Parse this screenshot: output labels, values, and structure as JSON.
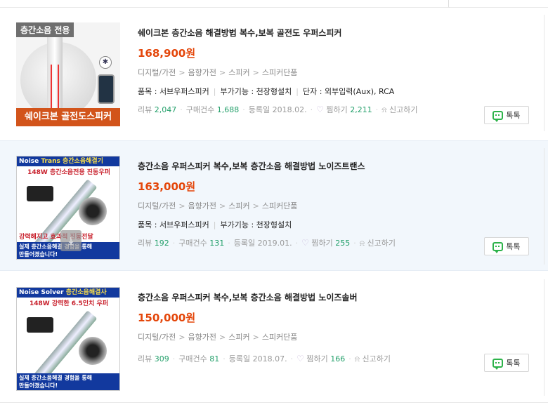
{
  "products": [
    {
      "title": "쉐이크본 층간소음 해결방법 복수,보복 골전도 우퍼스피커",
      "price": "168,900원",
      "categories": [
        "디지털/가전",
        "음향가전",
        "스피커",
        "스피커단품"
      ],
      "specs": [
        "품목 : 서브우퍼스피커",
        "부가기능 : 천장형설치",
        "단자 : 외부입력(Aux), RCA"
      ],
      "review_label": "리뷰",
      "review_count": "2,047",
      "purchase_label": "구매건수",
      "purchase_count": "1,688",
      "reg_label": "등록일 2018.02.",
      "wish_label": "찜하기",
      "wish_count": "2,211",
      "report_label": "신고하기",
      "talk_label": "톡톡",
      "thumb": {
        "badge": "층간소음 전용",
        "footer": "쉐이크본 골전도스피커",
        "bt_glyph": "✱"
      }
    },
    {
      "title": "층간소음 우퍼스피커 복수,보복 층간소음 해결방법 노이즈트랜스",
      "price": "163,000원",
      "categories": [
        "디지털/가전",
        "음향가전",
        "스피커",
        "스피커단품"
      ],
      "specs": [
        "품목 : 서브우퍼스피커",
        "부가기능 : 천장형설치"
      ],
      "review_label": "리뷰",
      "review_count": "192",
      "purchase_label": "구매건수",
      "purchase_count": "131",
      "reg_label": "등록일 2019.01.",
      "wish_label": "찜하기",
      "wish_count": "255",
      "report_label": "신고하기",
      "talk_label": "톡톡",
      "thumb": {
        "header_a": "Noise",
        "header_b": "Trans",
        "header_c": "층간소음해결기",
        "sub": "148W 층간소음전용 진동우퍼",
        "red": "강력해지고 효과적 진동전달",
        "foot1": "실제 층간소음해결 경험을 통해",
        "foot2": "만들어졌습니다!",
        "download_glyph": "⤓"
      }
    },
    {
      "title": "층간소음 우퍼스피커 복수,보복 층간소음 해결방법 노이즈솔버",
      "price": "150,000원",
      "categories": [
        "디지털/가전",
        "음향가전",
        "스피커",
        "스피커단품"
      ],
      "specs": [],
      "review_label": "리뷰",
      "review_count": "309",
      "purchase_label": "구매건수",
      "purchase_count": "81",
      "reg_label": "등록일 2018.07.",
      "wish_label": "찜하기",
      "wish_count": "166",
      "report_label": "신고하기",
      "talk_label": "톡톡",
      "thumb": {
        "header_a": "Noise Solver",
        "header_c": "층간소음해결사",
        "sub": "148W 강력한 6.5인치 우퍼",
        "foot1": "실제 층간소음해결 경험을 통해",
        "foot2": "만들어졌습니다!"
      }
    }
  ],
  "separators": {
    "category": ">",
    "spec": "|",
    "meta": "·"
  },
  "icons": {
    "wish": "heart-icon",
    "report": "bell-icon",
    "talk": "talk-bubble-icon"
  },
  "colors": {
    "price": "#e4460a",
    "count": "#24a06b",
    "talk": "#2db34a"
  }
}
